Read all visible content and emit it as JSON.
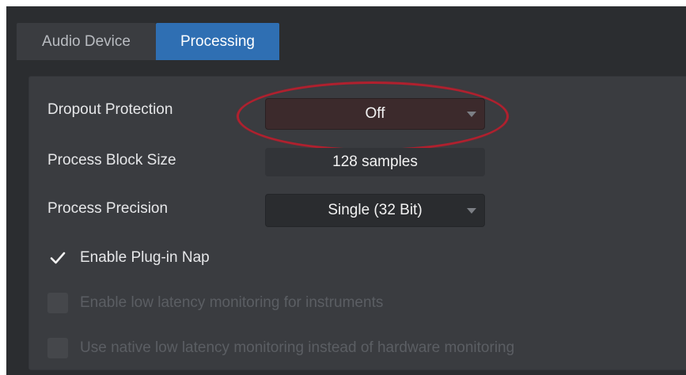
{
  "tabs": [
    {
      "label": "Audio Device",
      "active": false
    },
    {
      "label": "Processing",
      "active": true
    }
  ],
  "settings": {
    "dropout_protection": {
      "label": "Dropout Protection",
      "value": "Off"
    },
    "process_block_size": {
      "label": "Process Block Size",
      "value": "128 samples"
    },
    "process_precision": {
      "label": "Process Precision",
      "value": "Single (32 Bit)"
    }
  },
  "checkboxes": [
    {
      "label": "Enable Plug-in Nap",
      "checked": true,
      "enabled": true
    },
    {
      "label": "Enable low latency monitoring for instruments",
      "checked": false,
      "enabled": false
    },
    {
      "label": "Use native low latency monitoring instead of hardware monitoring",
      "checked": false,
      "enabled": false
    }
  ],
  "colors": {
    "active_tab": "#2f6fb3",
    "highlight": "#b0202e",
    "panel": "#3a3c40",
    "background": "#2b2d30"
  },
  "icons": {
    "dropdown": "chevron-down-icon",
    "check": "checkmark-icon"
  }
}
